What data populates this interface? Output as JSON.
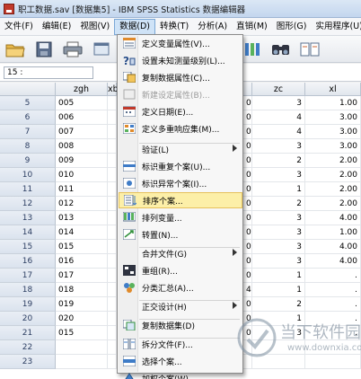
{
  "window": {
    "title": "职工数据.sav [数据集5] - IBM SPSS Statistics 数据编辑器"
  },
  "menubar": [
    {
      "label": "文件(F)"
    },
    {
      "label": "编辑(E)"
    },
    {
      "label": "视图(V)"
    },
    {
      "label": "数据(D)",
      "active": true
    },
    {
      "label": "转换(T)"
    },
    {
      "label": "分析(A)"
    },
    {
      "label": "直销(M)"
    },
    {
      "label": "图形(G)"
    },
    {
      "label": "实用程序(U)"
    }
  ],
  "toolbar": {
    "left_icons": [
      "open-folder-icon",
      "save-icon",
      "print-icon",
      "dialog-recall-icon"
    ],
    "right_icons": [
      "variables-icon",
      "find-icon",
      "split-file-icon"
    ]
  },
  "cellbar": {
    "ref": "15 :"
  },
  "grid": {
    "columns": [
      "zgh",
      "xb",
      "",
      "zc",
      "xl"
    ],
    "rows": [
      {
        "num": "5",
        "zgh": "005",
        "c3": "0",
        "zc": "3",
        "xl": "1.00"
      },
      {
        "num": "6",
        "zgh": "006",
        "c3": "0",
        "zc": "4",
        "xl": "3.00"
      },
      {
        "num": "7",
        "zgh": "007",
        "c3": "0",
        "zc": "4",
        "xl": "3.00"
      },
      {
        "num": "8",
        "zgh": "008",
        "c3": "0",
        "zc": "3",
        "xl": "3.00"
      },
      {
        "num": "9",
        "zgh": "009",
        "c3": "0",
        "zc": "2",
        "xl": "2.00"
      },
      {
        "num": "10",
        "zgh": "010",
        "c3": "0",
        "zc": "3",
        "xl": "2.00"
      },
      {
        "num": "11",
        "zgh": "011",
        "c3": "0",
        "zc": "1",
        "xl": "2.00"
      },
      {
        "num": "12",
        "zgh": "012",
        "c3": "0",
        "zc": "2",
        "xl": "2.00"
      },
      {
        "num": "13",
        "zgh": "013",
        "c3": "0",
        "zc": "3",
        "xl": "4.00"
      },
      {
        "num": "14",
        "zgh": "014",
        "c3": "0",
        "zc": "3",
        "xl": "1.00"
      },
      {
        "num": "15",
        "zgh": "015",
        "c3": "0",
        "zc": "3",
        "xl": "4.00"
      },
      {
        "num": "16",
        "zgh": "016",
        "c3": "0",
        "zc": "3",
        "xl": "4.00"
      },
      {
        "num": "17",
        "zgh": "017",
        "c3": "0",
        "zc": "1",
        "xl": "."
      },
      {
        "num": "18",
        "zgh": "018",
        "c3": "4",
        "zc": "1",
        "xl": "."
      },
      {
        "num": "19",
        "zgh": "019",
        "c3": "0",
        "zc": "2",
        "xl": "."
      },
      {
        "num": "20",
        "zgh": "020",
        "c3": "0",
        "zc": "1",
        "xl": "."
      },
      {
        "num": "21",
        "zgh": "015",
        "c3": "0",
        "zc": "3",
        "xl": "."
      },
      {
        "num": "22",
        "zgh": "",
        "c3": "",
        "zc": "",
        "xl": ""
      },
      {
        "num": "23",
        "zgh": "",
        "c3": "",
        "zc": "",
        "xl": ""
      }
    ]
  },
  "dropdown": {
    "items": [
      {
        "label": "定义变量属性(V)...",
        "icon": "define-properties-icon"
      },
      {
        "label": "设置未知测量级别(L)...",
        "icon": "unknown-measure-icon"
      },
      {
        "label": "复制数据属性(C)...",
        "icon": "copy-properties-icon"
      },
      {
        "label": "新建设定属性(B)...",
        "icon": "new-attribute-icon",
        "disabled": true
      },
      {
        "label": "定义日期(E)...",
        "icon": "define-dates-icon"
      },
      {
        "label": "定义多重响应集(M)...",
        "icon": "multiple-response-icon"
      },
      {
        "label": "验证(L)",
        "icon": "",
        "submenu": true
      },
      {
        "label": "标识重复个案(U)...",
        "icon": "duplicate-cases-icon"
      },
      {
        "label": "标识异常个案(I)...",
        "icon": "unusual-cases-icon"
      },
      {
        "label": "排序个案...",
        "icon": "sort-cases-icon",
        "highlighted": true
      },
      {
        "label": "排列变量...",
        "icon": "sort-variables-icon"
      },
      {
        "label": "转置(N)...",
        "icon": "transpose-icon"
      },
      {
        "label": "合并文件(G)",
        "icon": "",
        "submenu": true
      },
      {
        "label": "重组(R)...",
        "icon": "restructure-icon"
      },
      {
        "label": "分类汇总(A)...",
        "icon": "aggregate-icon"
      },
      {
        "label": "正交设计(H)",
        "icon": "",
        "submenu": true
      },
      {
        "label": "复制数据集(D)",
        "icon": "copy-dataset-icon"
      },
      {
        "label": "拆分文件(F)...",
        "icon": "split-file-icon"
      },
      {
        "label": "选择个案...",
        "icon": "select-cases-icon"
      },
      {
        "label": "加权个案(W)...",
        "icon": "weight-cases-icon"
      }
    ]
  },
  "watermark": {
    "text": "当下软件园",
    "url": "www.downxia.com"
  }
}
